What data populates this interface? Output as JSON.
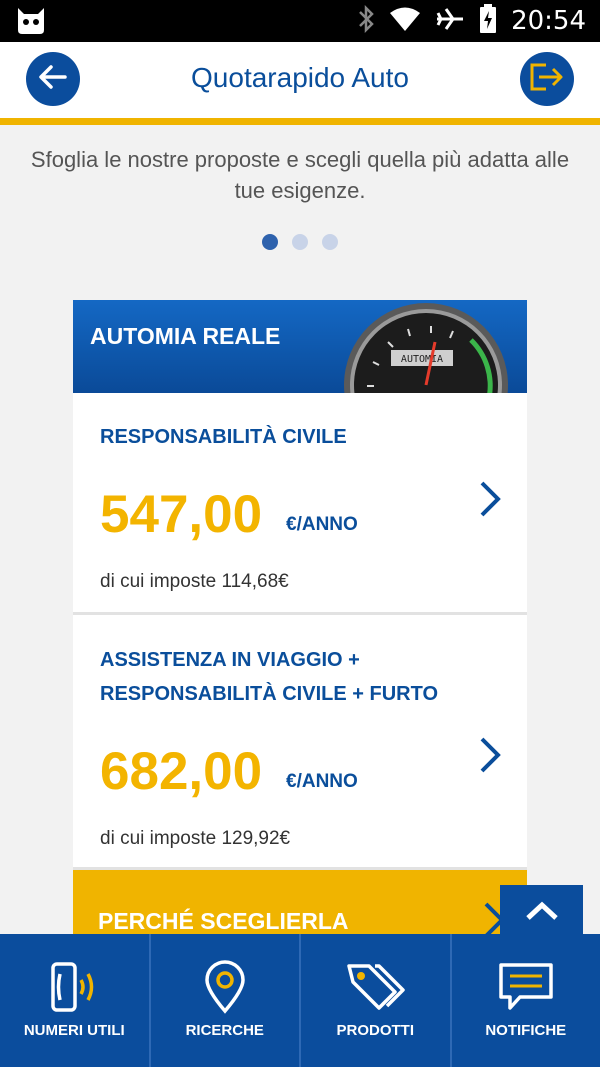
{
  "status_bar": {
    "time": "20:54",
    "icons": [
      "cyanogen-mascot-icon",
      "bluetooth-icon",
      "wifi-icon",
      "airplane-icon",
      "battery-icon"
    ]
  },
  "header": {
    "title": "Quotarapido Auto",
    "back_icon": "arrow-left-icon",
    "exit_icon": "logout-arrow-icon"
  },
  "intro_text": "Sfoglia le nostre proposte e scegli quella più adatta alle tue esigenze.",
  "pagination": {
    "total": 3,
    "active": 1
  },
  "card": {
    "name": "AUTOMIA REALE",
    "gauge_label": "AUTOMIA",
    "offers": [
      {
        "title_lines": [
          "RESPONSABILITÀ CIVILE"
        ],
        "price": "547,00",
        "unit": "€/ANNO",
        "tax": "di cui imposte 114,68€"
      },
      {
        "title_lines": [
          "ASSISTENZA IN VIAGGIO +",
          "RESPONSABILITÀ CIVILE + FURTO"
        ],
        "price": "682,00",
        "unit": "€/ANNO",
        "tax": "di cui imposte 129,92€"
      }
    ],
    "why_label": "PERCHÉ SCEGLIERLA"
  },
  "bottom_nav": [
    {
      "label": "NUMERI UTILI",
      "icon": "phone-ringing-icon"
    },
    {
      "label": "RICERCHE",
      "icon": "map-pin-icon"
    },
    {
      "label": "PRODOTTI",
      "icon": "tags-icon"
    },
    {
      "label": "NOTIFICHE",
      "icon": "chat-bubble-icon"
    }
  ],
  "colors": {
    "brand_blue": "#0b4d9d",
    "accent_yellow": "#f0b400",
    "price_yellow": "#f3b400"
  }
}
